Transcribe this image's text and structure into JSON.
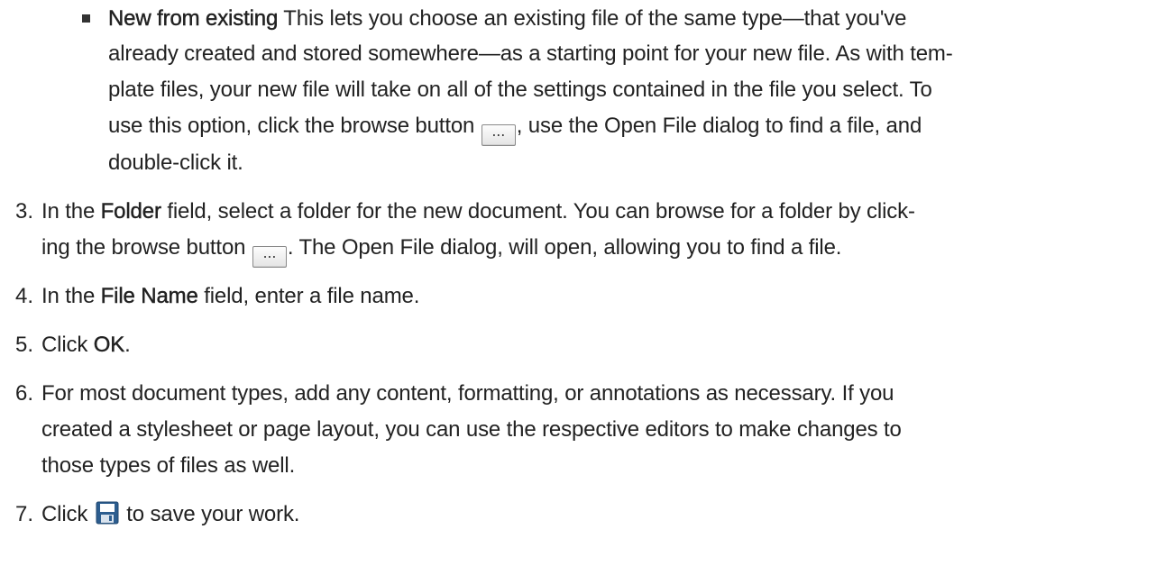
{
  "existing": {
    "title": "New from existing",
    "line1_rest": " This lets you choose an existing file of the same type—that you've",
    "line2": "already created and stored somewhere—as a starting point for your new file. As with tem-",
    "line3": "plate files, your new file will take on all of the settings contained in the file you select. To",
    "line4_pre": "use this option, click the browse button ",
    "line4_post": ", use the Open File dialog to find a file, and",
    "line5": "double-click it."
  },
  "browse_button": {
    "label": "..."
  },
  "steps": [
    {
      "num": "3.",
      "l1_pre": "In the ",
      "l1_bold": "Folder",
      "l1_post": " field, select a folder for the new document. You can browse for a folder by click-",
      "l2_pre": "ing the browse button ",
      "l2_post": ". The Open File dialog, will open, allowing you to find a file."
    },
    {
      "num": "4.",
      "pre": "In the ",
      "bold": "File Name",
      "post": " field, enter a file name."
    },
    {
      "num": "5.",
      "pre": "Click ",
      "bold": "OK",
      "post": "."
    },
    {
      "num": "6.",
      "l1": "For most document types, add any content, formatting, or annotations as necessary. If you",
      "l2": "created a stylesheet or page layout, you can use the respective editors to make changes to",
      "l3": "those types of files as well."
    },
    {
      "num": "7.",
      "pre": "Click ",
      "post": " to save your work.",
      "icon": "save-icon"
    }
  ]
}
